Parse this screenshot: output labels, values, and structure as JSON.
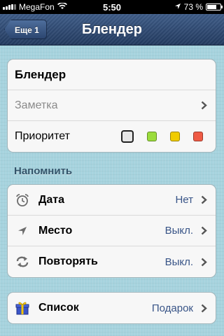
{
  "status_bar": {
    "carrier": "MegaFon",
    "time": "5:50",
    "battery_percent": "73 %",
    "battery_level": 0.73
  },
  "nav": {
    "back_label": "Еще 1",
    "title": "Блендер"
  },
  "task": {
    "title": "Блендер",
    "note_placeholder": "Заметка",
    "priority_label": "Приоритет",
    "priority_colors": [
      "#e6e6e6",
      "#9bdc3c",
      "#f0cc00",
      "#ef5b45"
    ],
    "priority_selected": 0
  },
  "remind": {
    "header": "Напомнить",
    "rows": [
      {
        "label": "Дата",
        "value": "Нет",
        "icon": "alarm-clock-icon"
      },
      {
        "label": "Место",
        "value": "Выкл.",
        "icon": "location-arrow-icon"
      },
      {
        "label": "Повторять",
        "value": "Выкл.",
        "icon": "repeat-icon"
      }
    ]
  },
  "list": {
    "label": "Список",
    "value": "Подарок",
    "icon": "gift-icon"
  }
}
